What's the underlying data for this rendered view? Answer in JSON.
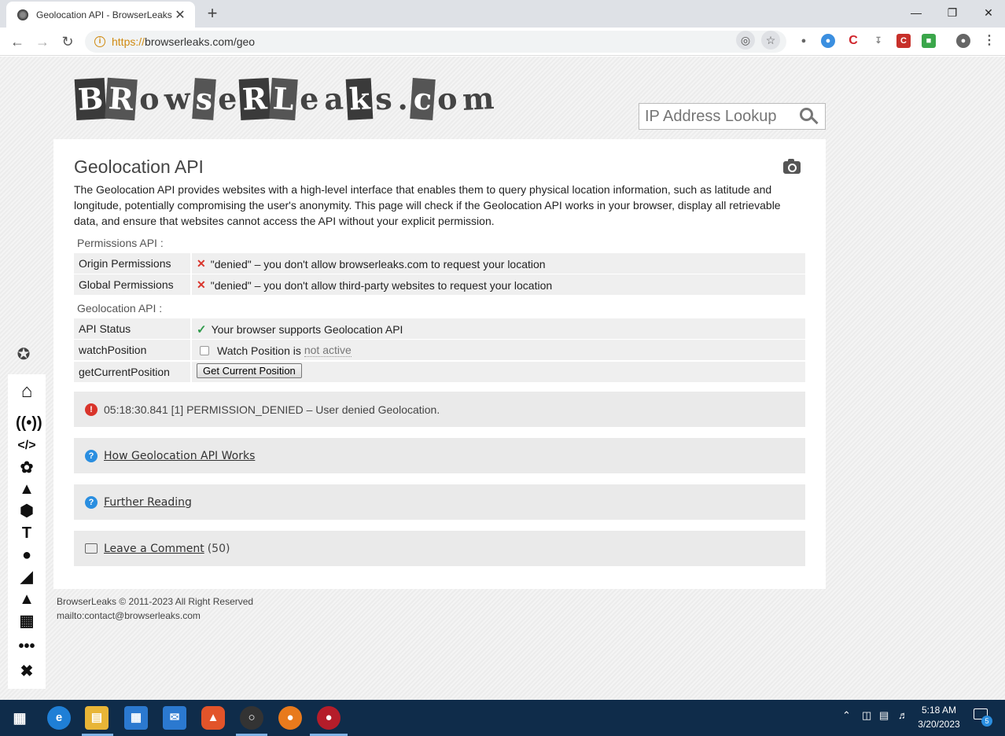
{
  "browser": {
    "tab_title": "Geolocation API - BrowserLeaks",
    "tab_close": "✕",
    "new_tab": "+",
    "url_scheme": "https://",
    "url_rest": "browserleaks.com/geo",
    "window_minimize": "—",
    "window_restore": "❐",
    "window_close": "✕"
  },
  "site": {
    "logo_text": "BrowserLeaks.com",
    "search_placeholder": "IP Address Lookup"
  },
  "main": {
    "title": "Geolocation API",
    "description": "The Geolocation API provides websites with a high-level interface that enables them to query physical location information, such as latitude and longitude, potentially compromising the user's anonymity. This page will check if the Geolocation API works in your browser, display all retrievable data, and ensure that websites cannot access the API without your explicit permission.",
    "permissions_label": "Permissions API :",
    "permissions": [
      {
        "key": "Origin Permissions",
        "value": "\"denied\" – you don't allow browserleaks.com to request your location"
      },
      {
        "key": "Global Permissions",
        "value": "\"denied\" – you don't allow third-party websites to request your location"
      }
    ],
    "geo_label": "Geolocation API :",
    "api_status_key": "API Status",
    "api_status_value": "Your browser supports Geolocation API",
    "watch_key": "watchPosition",
    "watch_text": "Watch Position is",
    "watch_state": "not active",
    "current_key": "getCurrentPosition",
    "current_button": "Get Current Position",
    "error_message": "05:18:30.841 [1] PERMISSION_DENIED – User denied Geolocation.",
    "link_how": "How Geolocation API Works",
    "link_further": "Further Reading",
    "link_comment": "Leave a Comment",
    "comment_count": "(50)"
  },
  "footer": {
    "copyright": "BrowserLeaks © 2011-2023 All Right Reserved",
    "mailto": "mailto:contact@browserleaks.com"
  },
  "taskbar": {
    "time": "5:18 AM",
    "date": "3/20/2023",
    "notification_count": "5"
  },
  "colors": {
    "error_red": "#d9342b",
    "ok_green": "#2e9a4a",
    "info_blue": "#2a8ee0",
    "taskbar": "#0f2c4a"
  }
}
